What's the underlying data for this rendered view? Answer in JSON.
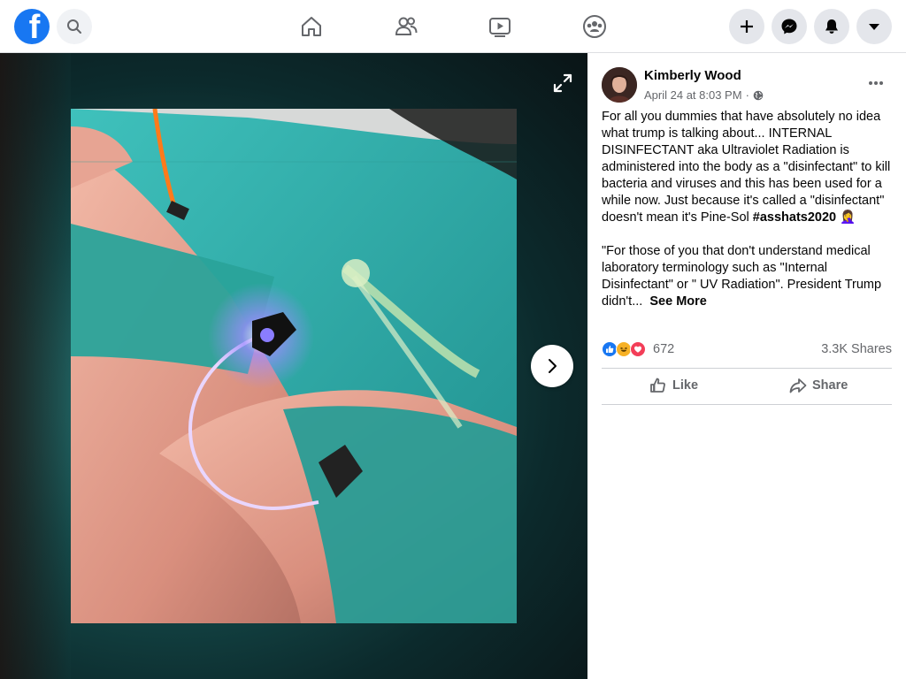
{
  "header": {
    "logo_letter": "f",
    "nav": [
      {
        "name": "home-icon"
      },
      {
        "name": "friends-icon"
      },
      {
        "name": "watch-icon"
      },
      {
        "name": "groups-icon"
      }
    ],
    "right_buttons": [
      {
        "name": "create-icon"
      },
      {
        "name": "messenger-icon"
      },
      {
        "name": "notifications-icon"
      },
      {
        "name": "account-menu-icon"
      }
    ]
  },
  "post": {
    "author": "Kimberly Wood",
    "timestamp": "April 24 at 8:03 PM",
    "separator": "·",
    "privacy_icon": "globe-icon",
    "text_1": "For all you dummies that have absolutely no idea what trump is talking about... INTERNAL DISINFECTANT aka Ultraviolet Radiation is administered into the body as a \"disinfectant\" to kill bacteria and viruses and this has been used for a while now. Just because it's called a \"disinfectant\" doesn't mean it's Pine-Sol",
    "hashtag": "#asshats2020",
    "emoji": "🤦‍♀️",
    "text_2": "\"For those of you that don't understand medical laboratory terminology such as \"Internal Disinfectant\" or \" UV Radiation\". President Trump didn't...",
    "see_more": "See More",
    "reaction_icons": [
      "like-icon",
      "haha-icon",
      "love-icon"
    ],
    "reaction_count": "672",
    "shares": "3.3K Shares",
    "like_label": "Like",
    "share_label": "Share"
  },
  "colors": {
    "brand": "#1877f2",
    "secondary_text": "#65676b",
    "button_bg": "#e4e6eb",
    "viewer_bg": "#154c4c"
  }
}
